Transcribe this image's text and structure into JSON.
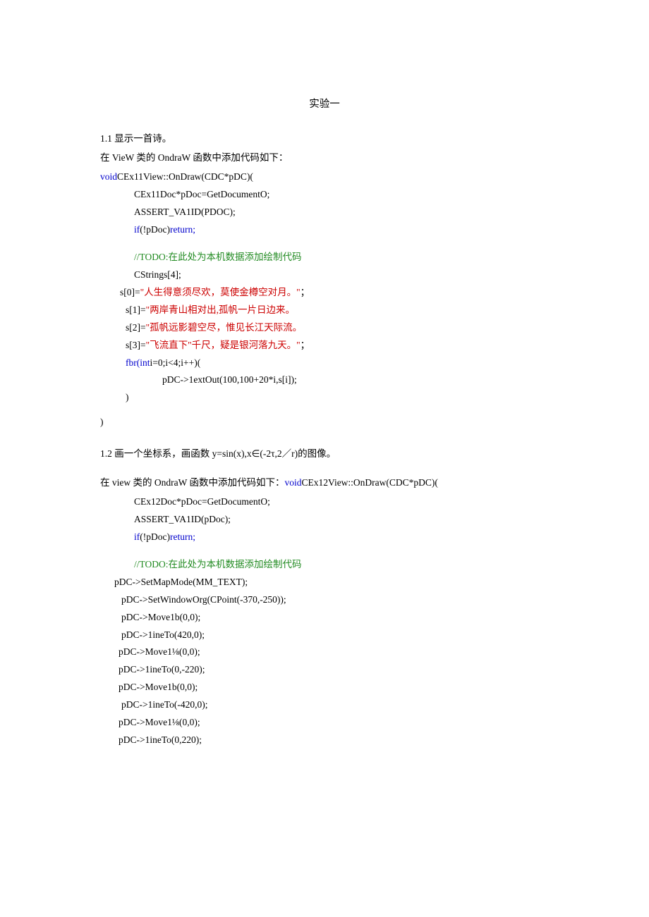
{
  "title": "实验一",
  "section1": {
    "heading": "1.1 显示一首诗。",
    "intro": "在 VieW 类的 OndraW 函数中添加代码如下：",
    "sig_pre": "void",
    "sig_rest": "CEx11View::OnDraw(CDC*pDC)(",
    "l1": "CEx11Doc*pDoc=GetDocumentO;",
    "l2": "ASSERT_VA1ID(PDOC);",
    "l3a": "if",
    "l3b": "(!pDoc)",
    "l3c": "return;",
    "comment1": "//TODO:在此处为本机数据添加绘制代码",
    "l4": "CStrings[4];",
    "s0a": "s[0]=",
    "s0b": "\"人生得意须尽欢，莫使金樽空对月。\"",
    "s0c": "；",
    "s1a": "s[1]=",
    "s1b": "\"两岸青山相对出,孤帆一片日边来。",
    "s2a": "s[2]=",
    "s2b": "\"孤帆远影碧空尽，惟见长江天际流。",
    "s3a": "s[3]=",
    "s3b": "\"飞流直下\"千尺，疑是银河落九天。\"",
    "s3c": "；",
    "fora": "fbr(int",
    "forb": "i=0;i<4;i++)(",
    "forbody": "pDC->1extOut(100,100+20*i,s[i]);",
    "rbrace1": ")",
    "rbrace2": ")"
  },
  "section2": {
    "heading": "1.2  画一个坐标系，画函数 y=sin(x),x∈(-2τ,2／r)的图像。",
    "intro_a": "在 view 类的 OndraW 函数中添加代码如下：",
    "intro_b": "void",
    "intro_c": "CEx12View::OnDraw(CDC*pDC)(",
    "l1": "CEx12Doc*pDoc=GetDocumentO;",
    "l2": "ASSERT_VA1ID(pDoc);",
    "l3a": "if",
    "l3b": "(!pDoc)",
    "l3c": "return;",
    "comment1": "//TODO:在此处为本机数据添加绘制代码",
    "m1": "pDC->SetMapMode(MM_TEXT);",
    "m2": "pDC->SetWindowOrg(CPoint(-370,-250));",
    "m3": "pDC->Move1b(0,0);",
    "m4": "pDC->1ineTo(420,0);",
    "m5": "pDC->Move1⅛(0,0);",
    "m6": "pDC->1ineTo(0,-220);",
    "m7": "pDC->Move1b(0,0);",
    "m8": "pDC->1ineTo(-420,0);",
    "m9": "pDC->Move1⅛(0,0);",
    "m10": "pDC->1ineTo(0,220);"
  }
}
